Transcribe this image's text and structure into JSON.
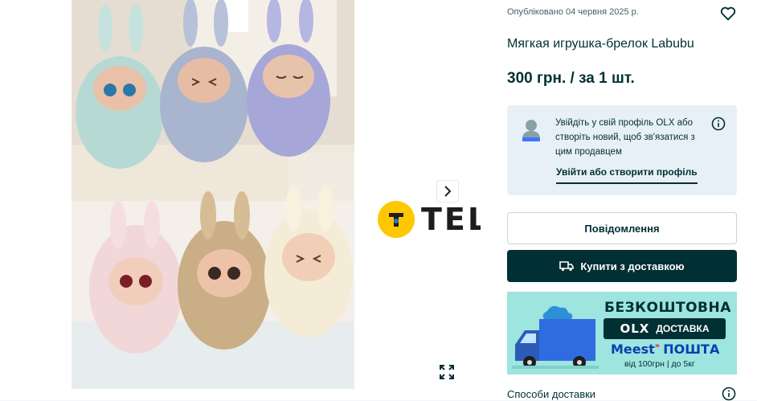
{
  "gallery": {
    "photo_alt": "",
    "next_icon": "chevron-right-icon",
    "expand_icon": "expand-icon"
  },
  "watermark": {
    "text": "TELEGRAF",
    "logo_color": "#ffc700"
  },
  "listing": {
    "posted": "Опубліковано 04 червня 2025 р.",
    "title": "Мягкая игрушка-брелок Labubu",
    "price": "300 грн. / за 1 шт."
  },
  "login_box": {
    "text": "Увійдіть у свій профіль OLX або створіть новий, щоб зв'язатися з цим продавцем",
    "link": "Увійти або створити профіль"
  },
  "buttons": {
    "message": "Повідомлення",
    "buy": "Купити з доставкою"
  },
  "banner": {
    "title": "БЕЗКОШТОВНА",
    "olx_logo": "OLX",
    "olx_label": "ДОСТАВКА",
    "meest_brand": "Meest",
    "meest_poshta": "ПОШТА",
    "note": "від 100грн | до 5кг"
  },
  "delivery": {
    "title": "Способи доставки"
  },
  "colors": {
    "primary": "#002f34",
    "banner_bg": "#9ee4df",
    "login_bg": "#e8f0f7",
    "meest_blue": "#0b3fb0"
  }
}
